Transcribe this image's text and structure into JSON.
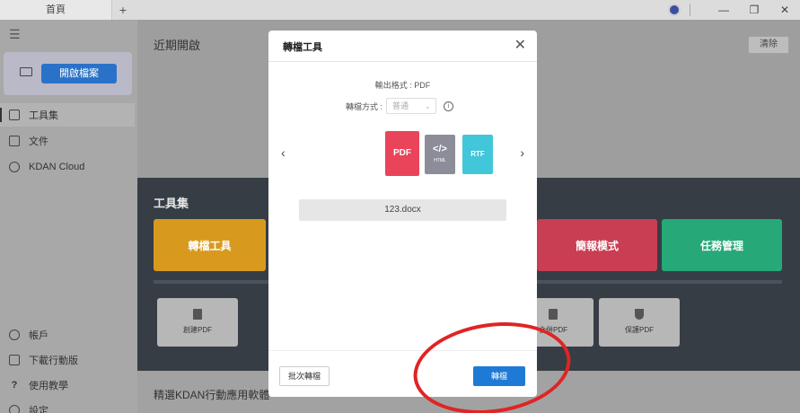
{
  "window": {
    "tab_label": "首頁",
    "tab_add": "+",
    "min_label": "—",
    "restore_label": "❐",
    "close_label": "✕"
  },
  "sidebar": {
    "menu_icon": "☰",
    "open_file_label": "開啟檔案",
    "items": [
      {
        "label": "工具集",
        "icon": "toolbox-icon"
      },
      {
        "label": "文件",
        "icon": "document-icon"
      },
      {
        "label": "KDAN Cloud",
        "icon": "cloud-icon"
      }
    ],
    "bottom_items": [
      {
        "label": "帳戶",
        "icon": "user-icon"
      },
      {
        "label": "下載行動版",
        "icon": "mobile-icon"
      },
      {
        "label": "使用教學",
        "icon": "help-icon"
      },
      {
        "label": "設定",
        "icon": "gear-icon"
      }
    ]
  },
  "main": {
    "recent_title": "近期開啟",
    "clear_label": "清除",
    "tools_title": "工具集",
    "tool_cards": [
      {
        "label": "轉檔工具",
        "color": "#f5a623"
      },
      {
        "label": "簡報模式",
        "color": "#e8455c"
      },
      {
        "label": "任務管理",
        "color": "#2cc48c"
      }
    ],
    "small_cards": [
      {
        "label": "創建PDF"
      },
      {
        "label": "合併PDF"
      },
      {
        "label": "保護PDF"
      }
    ],
    "bottom_title": "精選KDAN行動應用軟體"
  },
  "dialog": {
    "title": "轉檔工具",
    "close_icon": "✕",
    "output_format": "輸出格式 : PDF",
    "method_label": "轉檔方式 :",
    "method_value": "普通",
    "info_icon": "i",
    "arrow_left": "‹",
    "arrow_right": "›",
    "formats": [
      {
        "label": "PDF",
        "color": "#e9445a"
      },
      {
        "label": "</>",
        "sub": "HTML",
        "color": "#8d8d9a"
      },
      {
        "label": "RTF",
        "color": "#41c6da"
      }
    ],
    "filename": "123.docx",
    "batch_label": "批次轉檔",
    "convert_label": "轉檔"
  }
}
